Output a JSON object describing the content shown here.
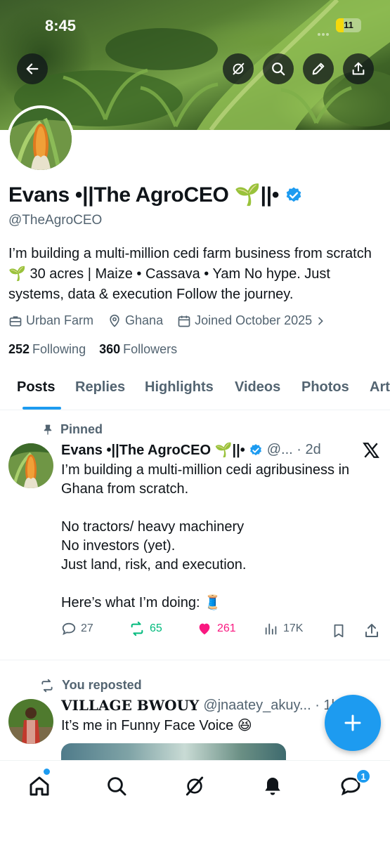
{
  "status_bar": {
    "time": "8:45",
    "battery": "11"
  },
  "profile": {
    "name": "Evans •||The AgroCEO 🌱||•",
    "handle": "@TheAgroCEO",
    "bio": "I’m building a multi-million cedi farm business from scratch 🌱 30 acres | Maize • Cassava • Yam No hype. Just systems, data & execution Follow the journey.",
    "category": "Urban Farm",
    "location": "Ghana",
    "joined": "Joined October 2025",
    "following_count": "252",
    "following_label": "Following",
    "followers_count": "360",
    "followers_label": "Followers"
  },
  "tabs": [
    "Posts",
    "Replies",
    "Highlights",
    "Videos",
    "Photos",
    "Art"
  ],
  "posts": [
    {
      "context": "Pinned",
      "name": "Evans •||The AgroCEO 🌱||•",
      "handle_time": "@... · 2d",
      "text": "I’m building a multi-million cedi agribusiness in\nGhana from scratch.\n\nNo tractors/ heavy machinery\nNo investors (yet).\nJust land, risk, and execution.\n\nHere’s what I’m doing: 🧵",
      "replies": "27",
      "reposts": "65",
      "likes": "261",
      "views": "17K"
    },
    {
      "context": "You reposted",
      "name": "𝐕𝐈𝐋𝐋𝐀𝐆𝐄 𝐁𝐖𝐎𝐔𝐘",
      "handle_time": "@jnaatey_akuy... · 1h",
      "text": "It’s me in Funny Face Voice 😆"
    }
  ],
  "notifications_badge": "1",
  "colors": {
    "accent": "#1d9bf0",
    "repost": "#00ba7c",
    "like": "#f91880",
    "text": "#0f1419",
    "muted": "#536471"
  }
}
